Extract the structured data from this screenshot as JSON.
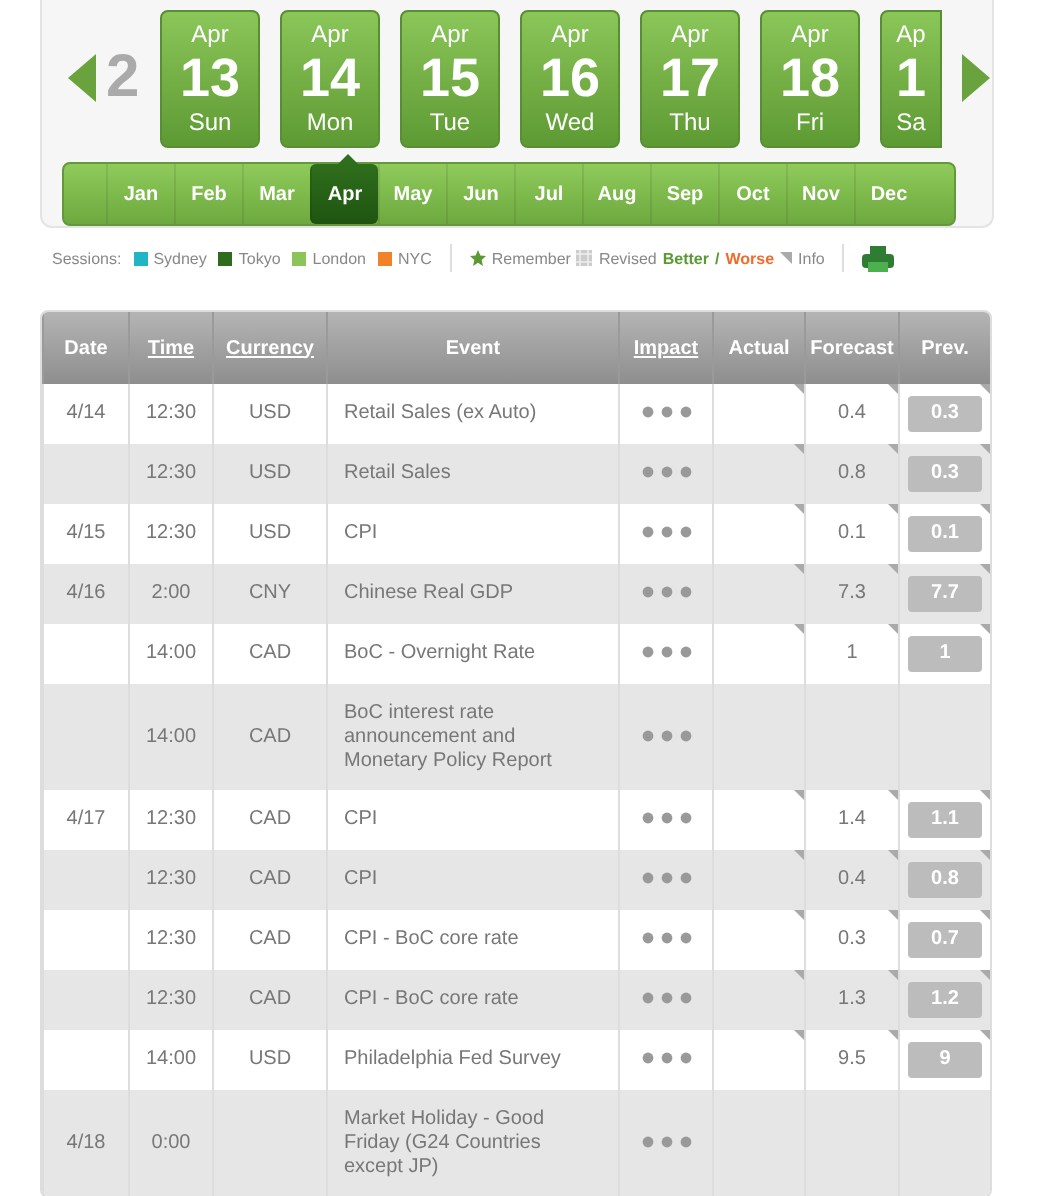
{
  "date_strip": {
    "previous_partial": "2",
    "days": [
      {
        "month": "Apr",
        "day": "13",
        "weekday": "Sun"
      },
      {
        "month": "Apr",
        "day": "14",
        "weekday": "Mon"
      },
      {
        "month": "Apr",
        "day": "15",
        "weekday": "Tue"
      },
      {
        "month": "Apr",
        "day": "16",
        "weekday": "Wed"
      },
      {
        "month": "Apr",
        "day": "17",
        "weekday": "Thu"
      },
      {
        "month": "Apr",
        "day": "18",
        "weekday": "Fri"
      },
      {
        "month": "Ap",
        "day": "1",
        "weekday": "Sa",
        "partial": true
      }
    ]
  },
  "months": [
    {
      "label": "Jan",
      "selected": false
    },
    {
      "label": "Feb",
      "selected": false
    },
    {
      "label": "Mar",
      "selected": false
    },
    {
      "label": "Apr",
      "selected": true
    },
    {
      "label": "May",
      "selected": false
    },
    {
      "label": "Jun",
      "selected": false
    },
    {
      "label": "Jul",
      "selected": false
    },
    {
      "label": "Aug",
      "selected": false
    },
    {
      "label": "Sep",
      "selected": false
    },
    {
      "label": "Oct",
      "selected": false
    },
    {
      "label": "Nov",
      "selected": false
    },
    {
      "label": "Dec",
      "selected": false
    }
  ],
  "legend": {
    "sessions_label": "Sessions:",
    "sessions": [
      {
        "label": "Sydney",
        "color": "#1fb5c4"
      },
      {
        "label": "Tokyo",
        "color": "#2e6b1f"
      },
      {
        "label": "London",
        "color": "#8cc459"
      },
      {
        "label": "NYC",
        "color": "#f0832a"
      }
    ],
    "remember": "Remember",
    "revised": "Revised",
    "better": "Better",
    "separator": "/",
    "worse": "Worse",
    "info": "Info"
  },
  "table": {
    "columns": [
      {
        "label": "Date",
        "sortable": false
      },
      {
        "label": "Time",
        "sortable": true
      },
      {
        "label": "Currency",
        "sortable": true
      },
      {
        "label": "Event",
        "sortable": false
      },
      {
        "label": "Impact",
        "sortable": true
      },
      {
        "label": "Actual",
        "sortable": false
      },
      {
        "label": "Forecast",
        "sortable": false
      },
      {
        "label": "Prev.",
        "sortable": false
      }
    ],
    "rows": [
      {
        "date": "4/14",
        "time": "12:30",
        "currency": "USD",
        "event": "Retail Sales (ex Auto)",
        "forecast": "0.4",
        "previous": "0.3",
        "info": true
      },
      {
        "time": "12:30",
        "currency": "USD",
        "event": "Retail Sales",
        "forecast": "0.8",
        "previous": "0.3",
        "info": true
      },
      {
        "date": "4/15",
        "time": "12:30",
        "currency": "USD",
        "event": "CPI",
        "forecast": "0.1",
        "previous": "0.1",
        "info": true
      },
      {
        "date": "4/16",
        "time": "2:00",
        "currency": "CNY",
        "event": "Chinese Real GDP",
        "forecast": "7.3",
        "previous": "7.7",
        "info": true
      },
      {
        "time": "14:00",
        "currency": "CAD",
        "event": "BoC - Overnight Rate",
        "forecast": "1",
        "previous": "1",
        "info": true
      },
      {
        "time": "14:00",
        "currency": "CAD",
        "event": "BoC interest rate announcement and Monetary Policy Report",
        "info": false
      },
      {
        "date": "4/17",
        "time": "12:30",
        "currency": "CAD",
        "event": "CPI",
        "forecast": "1.4",
        "previous": "1.1",
        "info": true
      },
      {
        "time": "12:30",
        "currency": "CAD",
        "event": "CPI",
        "forecast": "0.4",
        "previous": "0.8",
        "info": true
      },
      {
        "time": "12:30",
        "currency": "CAD",
        "event": "CPI - BoC core rate",
        "forecast": "0.3",
        "previous": "0.7",
        "info": true
      },
      {
        "time": "12:30",
        "currency": "CAD",
        "event": "CPI - BoC core rate",
        "forecast": "1.3",
        "previous": "1.2",
        "info": true
      },
      {
        "time": "14:00",
        "currency": "USD",
        "event": "Philadelphia Fed Survey",
        "forecast": "9.5",
        "previous": "9",
        "info": true
      },
      {
        "date": "4/18",
        "time": "0:00",
        "event": "Market Holiday - Good Friday (G24 Countries except JP)",
        "info": false
      }
    ]
  }
}
